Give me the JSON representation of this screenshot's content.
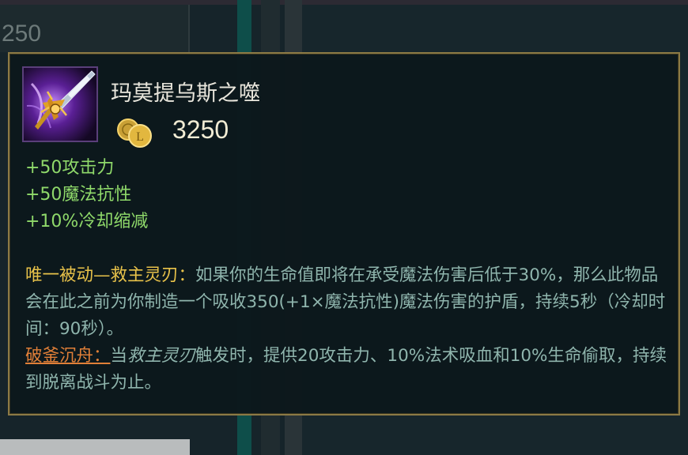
{
  "background": {
    "corner_number": "250"
  },
  "tooltip": {
    "item_name": "玛莫提乌斯之噬",
    "price": "3250",
    "stats": [
      "+50攻击力",
      "+50魔法抗性",
      "+10%冷却缩减"
    ],
    "passive1": {
      "label": "唯一被动—救主灵刃：",
      "text": "如果你的生命值即将在承受魔法伤害后低于30%，那么此物品会在此之前为你制造一个吸收350(+1×魔法抗性)魔法伤害的护盾，持续5秒（冷却时间：90秒）。"
    },
    "passive2": {
      "label": "破釜沉舟：",
      "text_before": "当",
      "italic_ref": "救主灵刃",
      "text_after": "触发时，提供20攻击力、10%法术吸血和10%生命偷取，持续到脱离战斗为止。"
    },
    "colors": {
      "border": "#8c7a45",
      "stat_green": "#8fd96a",
      "desc_teal": "#8fb5ad",
      "passive_yellow": "#e8c24a",
      "passive_orange": "#e07f38"
    },
    "icons": [
      "item-icon-sword",
      "gold-coin-icon"
    ]
  }
}
